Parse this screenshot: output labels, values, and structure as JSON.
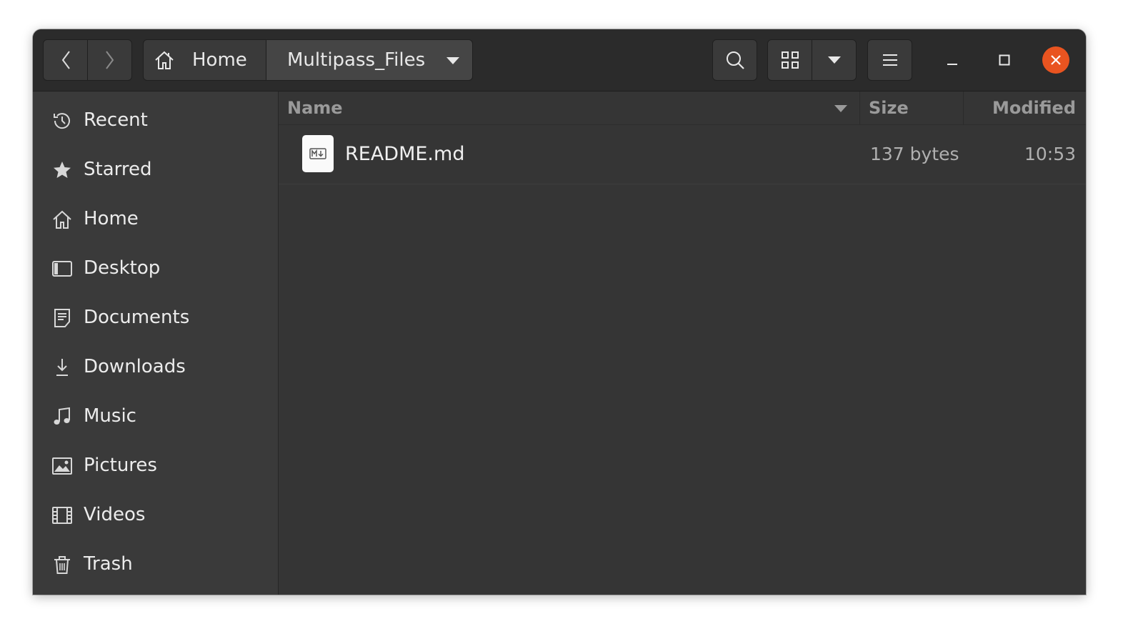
{
  "headerbar": {
    "path": {
      "home_label": "Home",
      "current_label": "Multipass_Files"
    }
  },
  "sidebar": {
    "items": [
      {
        "label": "Recent",
        "icon": "clock-icon"
      },
      {
        "label": "Starred",
        "icon": "star-icon"
      },
      {
        "label": "Home",
        "icon": "home-icon"
      },
      {
        "label": "Desktop",
        "icon": "desktop-icon"
      },
      {
        "label": "Documents",
        "icon": "documents-icon"
      },
      {
        "label": "Downloads",
        "icon": "download-icon"
      },
      {
        "label": "Music",
        "icon": "music-icon"
      },
      {
        "label": "Pictures",
        "icon": "pictures-icon"
      },
      {
        "label": "Videos",
        "icon": "videos-icon"
      },
      {
        "label": "Trash",
        "icon": "trash-icon"
      }
    ]
  },
  "file_list": {
    "columns": {
      "name": "Name",
      "size": "Size",
      "modified": "Modified"
    },
    "rows": [
      {
        "name": "README.md",
        "size": "137 bytes",
        "modified": "10:53",
        "icon": "markdown-file-icon"
      }
    ]
  },
  "colors": {
    "close_button": "#e95420",
    "window_bg": "#353535",
    "sidebar_bg": "#3a3a3a"
  }
}
